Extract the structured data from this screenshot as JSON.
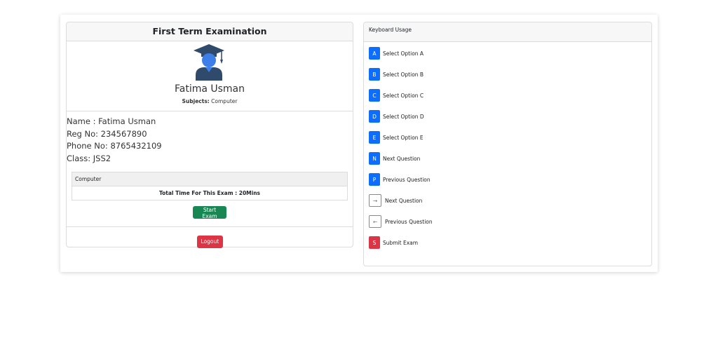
{
  "exam": {
    "title": "First Term Examination",
    "student_name": "Fatima Usman",
    "subjects_label": "Subjects:",
    "subjects_value": "Computer",
    "name_line": "Name : Fatima Usman",
    "reg_line": "Reg No: 234567890",
    "phone_line": "Phone No: 8765432109",
    "class_line": "Class: JSS2",
    "subject_row": "Computer",
    "time_row": "Total Time For This Exam : 20Mins",
    "start_button": "Start Exam",
    "logout_button": "Logout"
  },
  "keyboard": {
    "title": "Keyboard Usage",
    "items": [
      {
        "key": "A",
        "label": "Select Option A",
        "style": "blue"
      },
      {
        "key": "B",
        "label": "Select Option B",
        "style": "blue"
      },
      {
        "key": "C",
        "label": "Select Option C",
        "style": "blue"
      },
      {
        "key": "D",
        "label": "Select Option D",
        "style": "blue"
      },
      {
        "key": "E",
        "label": "Select Option E",
        "style": "blue"
      },
      {
        "key": "N",
        "label": "Next Question",
        "style": "blue"
      },
      {
        "key": "P",
        "label": "Previous Question",
        "style": "blue"
      },
      {
        "key": "→",
        "label": "Next Question",
        "style": "outline"
      },
      {
        "key": "←",
        "label": "Previous Question",
        "style": "outline"
      },
      {
        "key": "S",
        "label": "Submit Exam",
        "style": "red"
      }
    ]
  },
  "colors": {
    "primary": "#0d6efd",
    "success": "#198754",
    "danger": "#dc3545",
    "avatar": "#2f4a6b"
  },
  "icons": {
    "avatar": "graduate-user-icon"
  }
}
